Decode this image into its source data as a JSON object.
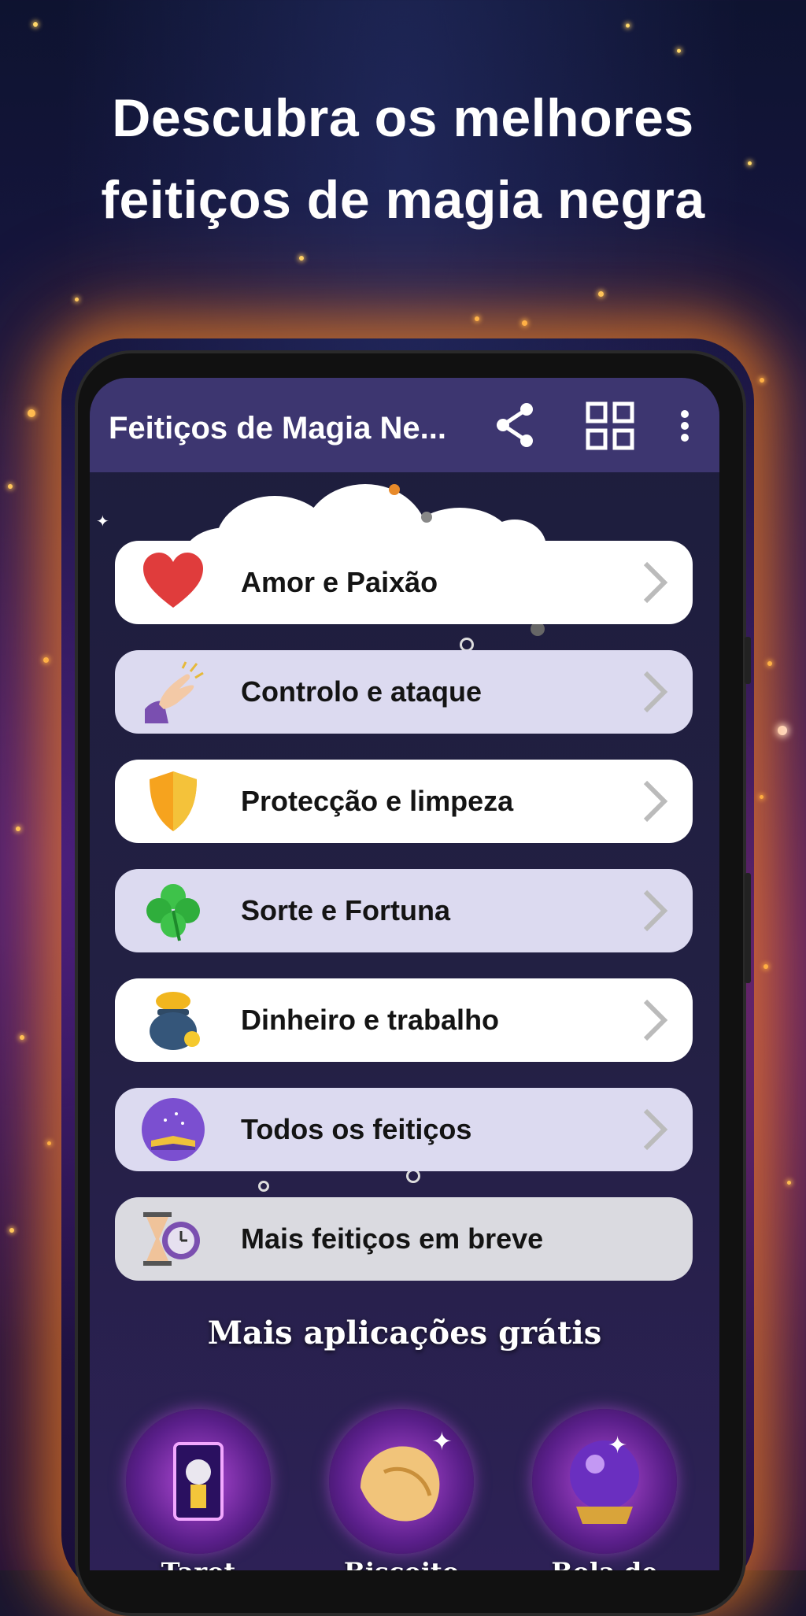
{
  "promo": {
    "headline_line1": "Descubra os melhores",
    "headline_line2": "feitiços de magia negra"
  },
  "appbar": {
    "title": "Feitiços de Magia Ne...",
    "share_icon": "share-icon",
    "grid_icon": "grid-view-icon",
    "menu_icon": "more-vertical-icon"
  },
  "menu": {
    "items": [
      {
        "label": "Amor e Paixão",
        "icon": "heart-icon"
      },
      {
        "label": "Controlo e ataque",
        "icon": "magic-hand-icon"
      },
      {
        "label": "Protecção e limpeza",
        "icon": "shield-icon"
      },
      {
        "label": "Sorte e Fortuna",
        "icon": "clover-icon"
      },
      {
        "label": "Dinheiro e trabalho",
        "icon": "pot-of-gold-icon"
      },
      {
        "label": "Todos os feitiços",
        "icon": "spellbook-icon"
      },
      {
        "label": "Mais feitiços em breve",
        "icon": "hourglass-clock-icon"
      }
    ]
  },
  "more_apps": {
    "title": "Mais aplicações grátis",
    "apps": [
      {
        "label": "Tarot",
        "icon": "tarot-icon"
      },
      {
        "label": "Biscoito",
        "icon": "fortune-cookie-icon"
      },
      {
        "label": "Bola de",
        "icon": "crystal-ball-icon"
      }
    ]
  },
  "colors": {
    "appbar": "#3d3670",
    "row_white": "#ffffff",
    "row_lavender": "#dcdaf0",
    "phone_glow": "#ff8c1e"
  }
}
